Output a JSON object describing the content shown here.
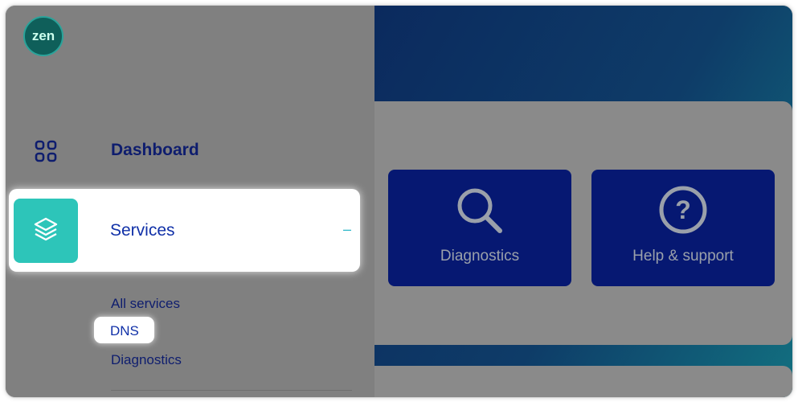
{
  "brand": {
    "logo_text": "zen"
  },
  "rail": {
    "icons": [
      "grid-icon",
      "layers-icon"
    ]
  },
  "nav": {
    "dashboard_label": "Dashboard",
    "services_label": "Services",
    "services_toggle": "–",
    "sub_items": [
      "All services",
      "DNS",
      "Diagnostics"
    ]
  },
  "tiles": [
    {
      "label": "Diagnostics",
      "icon": "search-icon"
    },
    {
      "label": "Help & support",
      "icon": "help-icon"
    }
  ],
  "colors": {
    "brand_teal": "#2dc5b9",
    "nav_text": "#0e1d6e",
    "active_text": "#1131a8",
    "tile_bg": "#061872"
  }
}
